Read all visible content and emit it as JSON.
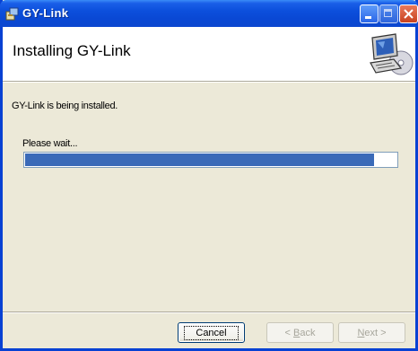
{
  "window": {
    "title": "GY-Link",
    "icon": "installer-package-icon",
    "controls": {
      "minimize": "minimize-icon",
      "maximize": "maximize-icon",
      "close": "close-icon"
    },
    "colors": {
      "titlebar": "#0a48d4",
      "close": "#c8421f",
      "face": "#ece9d8"
    }
  },
  "banner": {
    "title": "Installing GY-Link",
    "graphic": "computer-disc-icon"
  },
  "body": {
    "status": "GY-Link is being installed.",
    "wait": "Please wait...",
    "progress_percent": 94,
    "progress_color": "#3a6ab8"
  },
  "buttons": {
    "cancel": "Cancel",
    "back_prefix": "< ",
    "back_key": "B",
    "back_rest": "ack",
    "next_key": "N",
    "next_rest": "ext >"
  }
}
